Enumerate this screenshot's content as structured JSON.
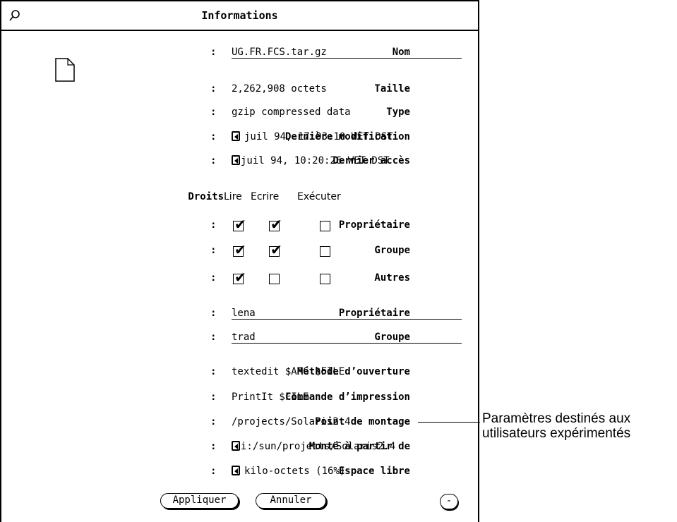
{
  "window": {
    "title": "Informations",
    "pin_icon": "pushpin-icon"
  },
  "fields": {
    "name_label": "Nom",
    "name_value": "UG.FR.FCS.tar.gz",
    "size_label": "Taille",
    "size_value": "2,262,908 octets",
    "type_label": "Type",
    "type_value": "gzip compressed data",
    "modified_label": "Dernière modification",
    "modified_value": "juil 94, 17:03:10 WET DST",
    "accessed_label": "Dernier accès",
    "accessed_value": "juil 94, 10:20:26 WET DST"
  },
  "permissions": {
    "header_label": "Droits",
    "columns": [
      "Lire",
      "Ecrire",
      "Exécuter"
    ],
    "rows": [
      {
        "label": "Propriétaire",
        "read": true,
        "write": true,
        "execute": false
      },
      {
        "label": "Groupe",
        "read": true,
        "write": true,
        "execute": false
      },
      {
        "label": "Autres",
        "read": true,
        "write": false,
        "execute": false
      }
    ]
  },
  "ownership": {
    "owner_label": "Propriétaire",
    "owner_value": "lena",
    "group_label": "Groupe",
    "group_value": "trad"
  },
  "advanced": {
    "open_method_label": "Méthode d’ouverture",
    "open_method_value": "textedit $ARG $FILE",
    "print_command_label": "Commande d’impression",
    "print_command_value": "PrintIt $FILE",
    "mount_point_label": "Point de montage",
    "mount_point_value": "/projects/Solaris2.4",
    "mounted_from_label": "Monté à partir de",
    "mounted_from_value": "i:/sun/projects/Solaris2.4",
    "free_space_label": "Espace libre",
    "free_space_value": "kilo-octets (16%)"
  },
  "buttons": {
    "apply": "Appliquer",
    "cancel": "Annuler",
    "less": "-"
  },
  "callout": {
    "line1": "Paramètres destinés aux",
    "line2": "utilisateurs expérimentés"
  },
  "colon": ":"
}
